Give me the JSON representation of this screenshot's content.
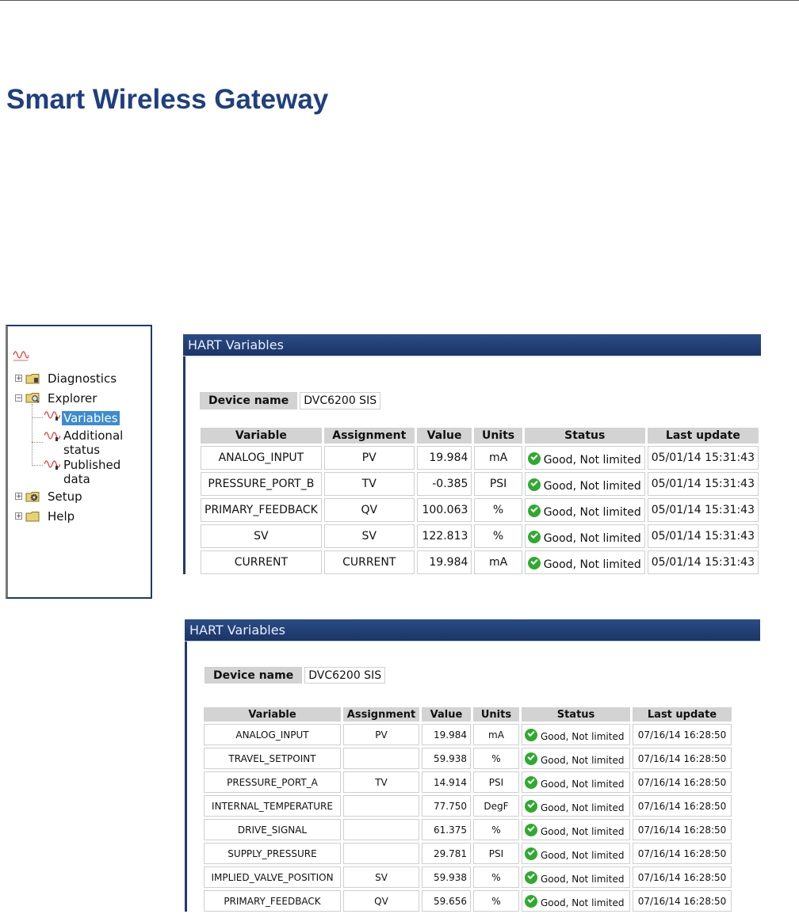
{
  "page": {
    "title": "Smart Wireless Gateway"
  },
  "tree": {
    "root_icon": "wave-icon",
    "items": [
      {
        "label": "Diagnostics",
        "icon": "folder-icon"
      },
      {
        "label": "Explorer",
        "icon": "folder-search-icon"
      },
      {
        "label": "Variables",
        "icon": "wave-icon",
        "selected": true
      },
      {
        "label_line1": "Additional",
        "label_line2": "status",
        "icon": "wave-icon"
      },
      {
        "label_line1": "Published",
        "label_line2": "data",
        "icon": "wave-icon"
      },
      {
        "label": "Setup",
        "icon": "folder-gear-icon"
      },
      {
        "label": "Help",
        "icon": "folder-icon"
      }
    ]
  },
  "panel1": {
    "header": "HART Variables",
    "device_label": "Device name",
    "device_value": "DVC6200 SIS",
    "columns": [
      "Variable",
      "Assignment",
      "Value",
      "Units",
      "Status",
      "Last update"
    ],
    "rows": [
      [
        "ANALOG_INPUT",
        "PV",
        "19.984",
        "mA",
        "Good, Not limited",
        "05/01/14 15:31:43"
      ],
      [
        "PRESSURE_PORT_B",
        "TV",
        "-0.385",
        "PSI",
        "Good, Not limited",
        "05/01/14 15:31:43"
      ],
      [
        "PRIMARY_FEEDBACK",
        "QV",
        "100.063",
        "%",
        "Good, Not limited",
        "05/01/14 15:31:43"
      ],
      [
        "SV",
        "SV",
        "122.813",
        "%",
        "Good, Not limited",
        "05/01/14 15:31:43"
      ],
      [
        "CURRENT",
        "CURRENT",
        "19.984",
        "mA",
        "Good, Not limited",
        "05/01/14 15:31:43"
      ]
    ]
  },
  "panel2": {
    "header": "HART Variables",
    "device_label": "Device name",
    "device_value": "DVC6200 SIS",
    "columns": [
      "Variable",
      "Assignment",
      "Value",
      "Units",
      "Status",
      "Last update"
    ],
    "rows": [
      [
        "ANALOG_INPUT",
        "PV",
        "19.984",
        "mA",
        "Good, Not limited",
        "07/16/14 16:28:50"
      ],
      [
        "TRAVEL_SETPOINT",
        "",
        "59.938",
        "%",
        "Good, Not limited",
        "07/16/14 16:28:50"
      ],
      [
        "PRESSURE_PORT_A",
        "TV",
        "14.914",
        "PSI",
        "Good, Not limited",
        "07/16/14 16:28:50"
      ],
      [
        "INTERNAL_TEMPERATURE",
        "",
        "77.750",
        "DegF",
        "Good, Not limited",
        "07/16/14 16:28:50"
      ],
      [
        "DRIVE_SIGNAL",
        "",
        "61.375",
        "%",
        "Good, Not limited",
        "07/16/14 16:28:50"
      ],
      [
        "SUPPLY_PRESSURE",
        "",
        "29.781",
        "PSI",
        "Good, Not limited",
        "07/16/14 16:28:50"
      ],
      [
        "IMPLIED_VALVE_POSITION",
        "SV",
        "59.938",
        "%",
        "Good, Not limited",
        "07/16/14 16:28:50"
      ],
      [
        "PRIMARY_FEEDBACK",
        "QV",
        "59.656",
        "%",
        "Good, Not limited",
        "07/16/14 16:28:50"
      ]
    ]
  },
  "colors": {
    "header_bg": "#1f3a6f",
    "title": "#1f3f7f",
    "status_ok": "#2faa2f",
    "selected": "#3d8bd0"
  }
}
